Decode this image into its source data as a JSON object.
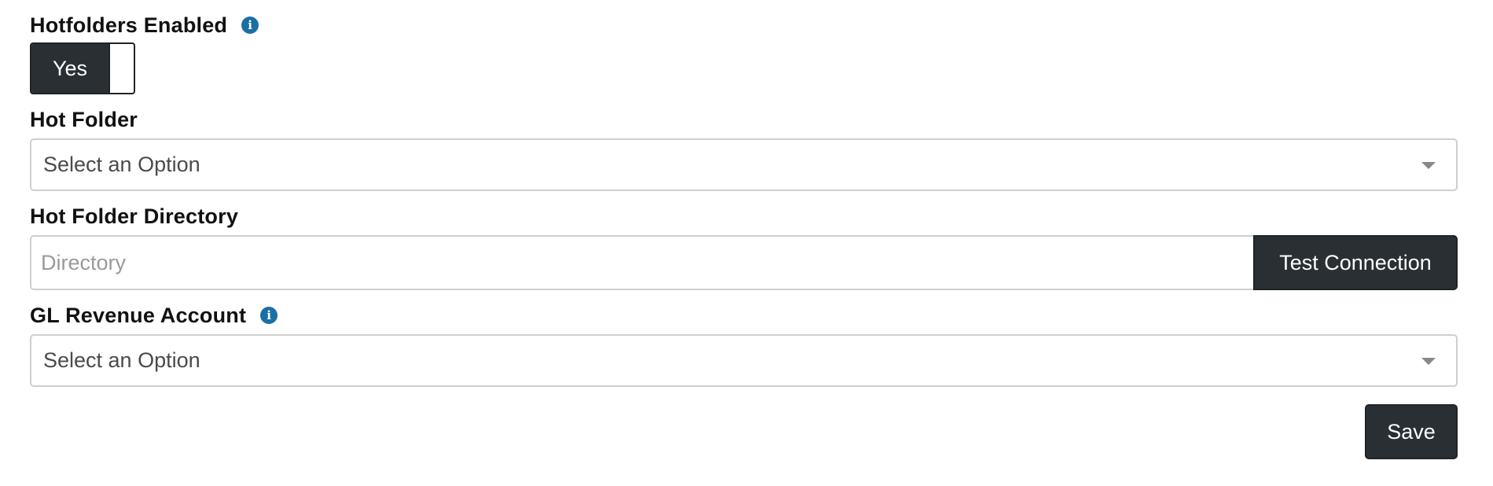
{
  "fields": {
    "hotfolders_enabled": {
      "label": "Hotfolders Enabled",
      "info_icon": "info-circle-icon",
      "toggle_label": "Yes",
      "toggle_state": true
    },
    "hot_folder": {
      "label": "Hot Folder",
      "selected": "Select an Option"
    },
    "hot_folder_directory": {
      "label": "Hot Folder Directory",
      "placeholder": "Directory",
      "value": "",
      "button_label": "Test Connection"
    },
    "gl_revenue_account": {
      "label": "GL Revenue Account",
      "info_icon": "info-circle-icon",
      "selected": "Select an Option"
    }
  },
  "actions": {
    "save_label": "Save"
  },
  "colors": {
    "dark_button": "#2a2f33",
    "info_icon": "#1b6fa6",
    "border": "#cfcfcf"
  }
}
